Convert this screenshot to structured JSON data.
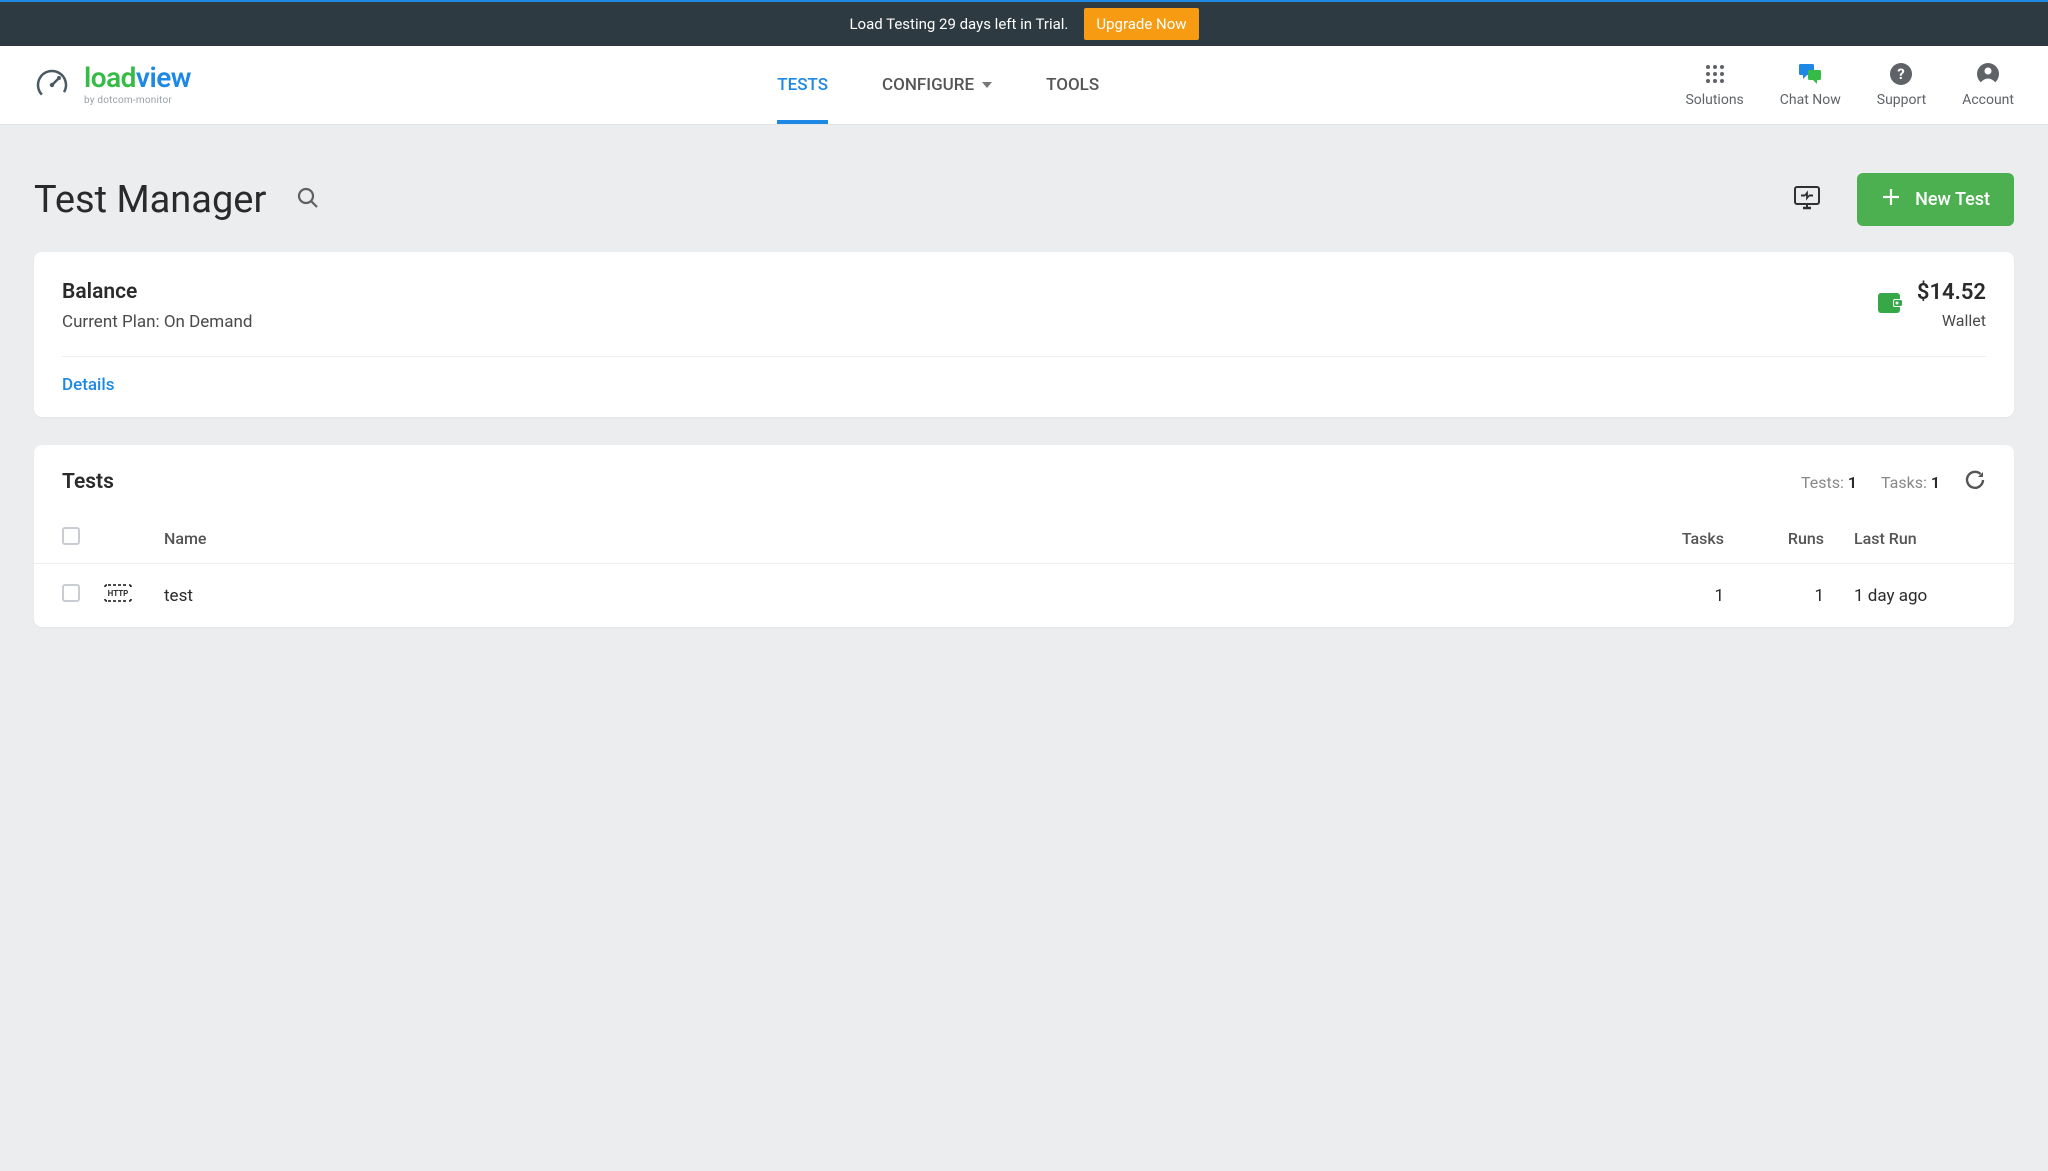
{
  "trial_banner": {
    "text": "Load Testing 29 days left in Trial.",
    "upgrade_label": "Upgrade Now"
  },
  "logo": {
    "part1": "load",
    "part2": "view",
    "subtitle": "by dotcom-monitor"
  },
  "nav_tabs": {
    "tests": "TESTS",
    "configure": "CONFIGURE",
    "tools": "TOOLS"
  },
  "nav_right": {
    "solutions": "Solutions",
    "chat": "Chat Now",
    "support": "Support",
    "account": "Account"
  },
  "page": {
    "title": "Test Manager",
    "new_test_label": "New Test"
  },
  "balance": {
    "title": "Balance",
    "plan_prefix": "Current Plan: ",
    "plan_value": "On Demand",
    "amount": "$14.52",
    "wallet_label": "Wallet",
    "details_label": "Details"
  },
  "tests_section": {
    "title": "Tests",
    "tests_label": "Tests:",
    "tests_count": "1",
    "tasks_label": "Tasks:",
    "tasks_count": "1",
    "columns": {
      "name": "Name",
      "tasks": "Tasks",
      "runs": "Runs",
      "last_run": "Last Run"
    },
    "rows": [
      {
        "name": "test",
        "tasks": "1",
        "runs": "1",
        "last_run": "1 day ago"
      }
    ]
  }
}
